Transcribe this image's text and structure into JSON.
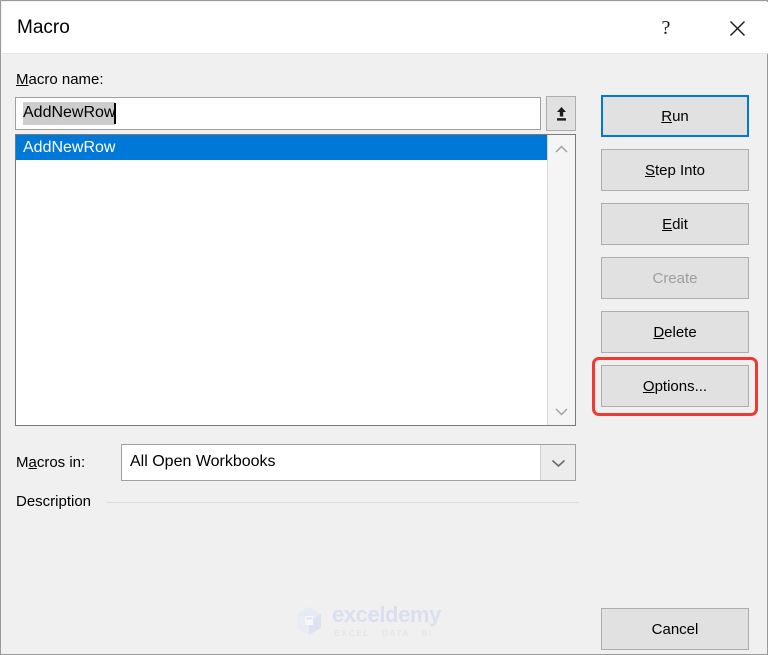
{
  "dialog": {
    "title": "Macro",
    "help_icon": "question-mark-icon",
    "close_icon": "close-icon"
  },
  "macro_name": {
    "label_prefix": "M",
    "label_rest": "acro name:",
    "value": "AddNewRow",
    "upload_icon": "upload-arrow-icon"
  },
  "macro_list": {
    "items": [
      {
        "label": "AddNewRow",
        "selected": true
      }
    ],
    "scroll_up_icon": "chevron-up-icon",
    "scroll_down_icon": "chevron-down-icon"
  },
  "macros_in": {
    "label_prefix": "M",
    "label_key": "a",
    "label_rest": "cros in:",
    "value": "All Open Workbooks",
    "options": [
      "All Open Workbooks"
    ],
    "dropdown_icon": "chevron-down-icon"
  },
  "description": {
    "label": "Description",
    "text": ""
  },
  "buttons": {
    "run": {
      "pre": "",
      "key": "R",
      "post": "un",
      "state": "focused"
    },
    "step_into": {
      "pre": "",
      "key": "S",
      "post": "tep Into",
      "state": "normal"
    },
    "edit": {
      "pre": "",
      "key": "E",
      "post": "dit",
      "state": "normal"
    },
    "create": {
      "pre": "Create",
      "key": "",
      "post": "",
      "state": "disabled"
    },
    "delete": {
      "pre": "",
      "key": "D",
      "post": "elete",
      "state": "normal"
    },
    "options": {
      "pre": "",
      "key": "O",
      "post": "ptions...",
      "state": "highlighted"
    },
    "cancel": {
      "pre": "Cancel",
      "key": "",
      "post": "",
      "state": "normal"
    }
  },
  "highlight": {
    "target": "options-button",
    "color": "#ee3a33"
  },
  "watermark": {
    "name": "exceldemy",
    "tagline": "EXCEL · DATA · BI"
  },
  "colors": {
    "accent": "#0078d7",
    "selection": "#0078d7",
    "dialog_bg": "#f0f0f0",
    "button_face": "#e1e1e1",
    "highlight_red": "#ee3a33"
  }
}
